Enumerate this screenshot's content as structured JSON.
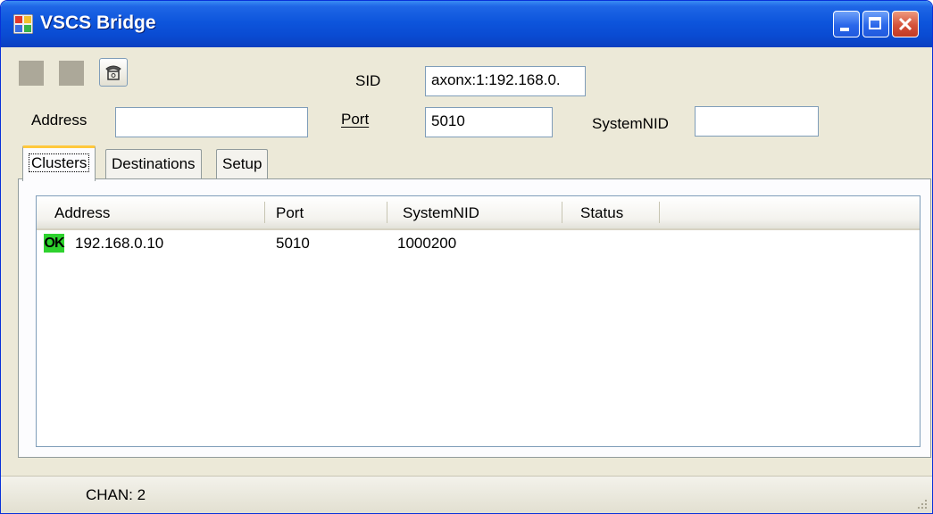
{
  "window": {
    "title": "VSCS Bridge"
  },
  "toolbar": {
    "phone_icon": "phone-icon"
  },
  "form": {
    "sid_label": "SID",
    "sid_value": "axonx:1:192.168.0.",
    "address_label": "Address",
    "address_value": "",
    "port_label": "Port",
    "port_value": "5010",
    "systemnid_label": "SystemNID",
    "systemnid_value": ""
  },
  "tabs": [
    {
      "label": "Clusters",
      "active": true
    },
    {
      "label": "Destinations",
      "active": false
    },
    {
      "label": "Setup",
      "active": false
    }
  ],
  "clusters": {
    "columns": [
      "Address",
      "Port",
      "SystemNID",
      "Status"
    ],
    "rows": [
      {
        "badge": "OK",
        "address": "192.168.0.10",
        "port": "5010",
        "systemnid": "1000200",
        "status": ""
      }
    ]
  },
  "statusbar": {
    "chan": "CHAN: 2"
  },
  "colors": {
    "title_blue": "#0a4bd2",
    "ok_green": "#2ed22e",
    "window_bg": "#ece9d8"
  }
}
